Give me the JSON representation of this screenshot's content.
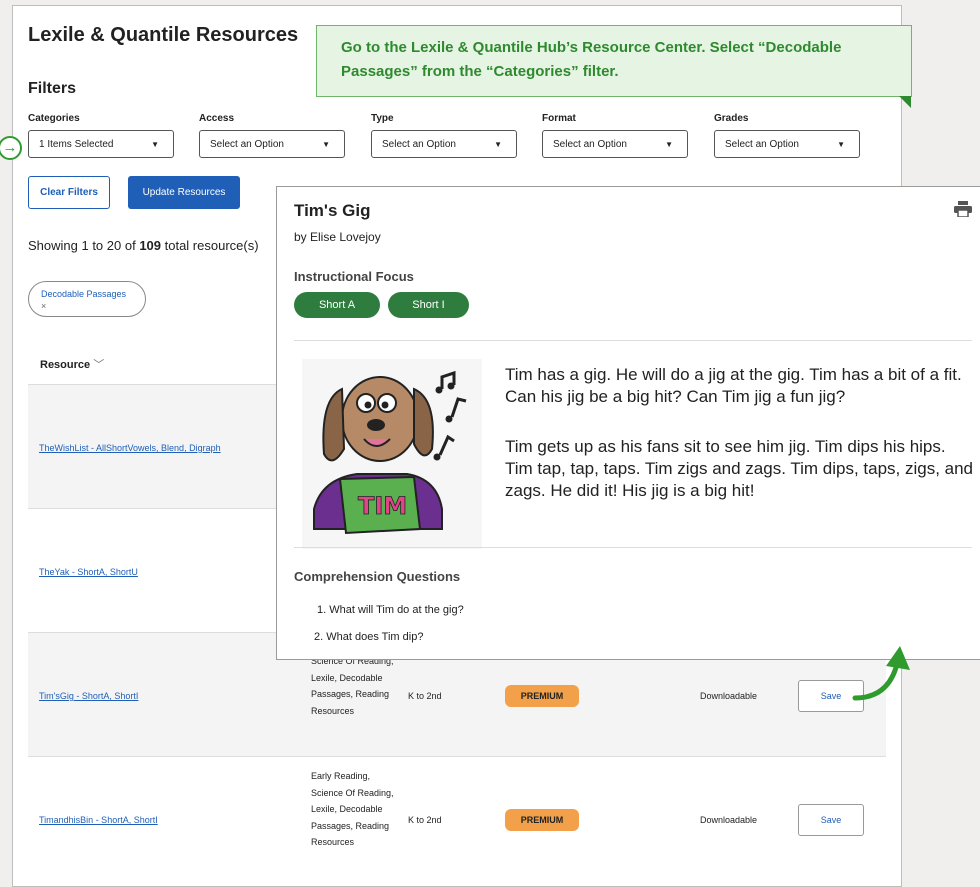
{
  "page": {
    "title": "Lexile & Quantile Resources",
    "filters_heading": "Filters"
  },
  "filters": [
    {
      "label": "Categories",
      "value": "1 Items Selected"
    },
    {
      "label": "Access",
      "value": "Select an Option"
    },
    {
      "label": "Type",
      "value": "Select an Option"
    },
    {
      "label": "Format",
      "value": "Select an Option"
    },
    {
      "label": "Grades",
      "value": "Select an Option"
    }
  ],
  "buttons": {
    "clear": "Clear Filters",
    "update": "Update Resources"
  },
  "results": {
    "prefix": "Showing 1 to 20 of ",
    "count": "109",
    "suffix": " total resource(s)"
  },
  "chip": {
    "label": "Decodable Passages",
    "remove": "×"
  },
  "table": {
    "column_resource": "Resource"
  },
  "rows": [
    {
      "name": "TheWishList - AllShortVowels, Blend, Digraph"
    },
    {
      "name": "TheYak - ShortA, ShortU"
    },
    {
      "name": "Tim'sGig - ShortA, ShortI",
      "categories": "Science Of Reading, Lexile, Decodable Passages, Reading Resources",
      "grades": "K to 2nd",
      "badge": "PREMIUM",
      "format": "Downloadable",
      "save": "Save"
    },
    {
      "name": "TimandhisBin - ShortA, ShortI",
      "categories": "Early Reading, Science Of Reading, Lexile, Decodable Passages, Reading Resources",
      "grades": "K to 2nd",
      "badge": "PREMIUM",
      "format": "Downloadable",
      "save": "Save"
    }
  ],
  "callout": {
    "text": "Go to the Lexile & Quantile Hub’s Resource Center. Select “Decodable Passages” from the “Categories” filter."
  },
  "modal": {
    "title": "Tim's Gig",
    "author": "by Elise Lovejoy",
    "focus_heading": "Instructional Focus",
    "focus_tags": [
      "Short A",
      "Short I"
    ],
    "paragraph1": "Tim has a gig. He will do a jig at the gig. Tim has a bit of a fit. Can his jig be a big hit? Can Tim jig a fun jig?",
    "paragraph2": "Tim gets up as his fans sit to see him jig. Tim dips his hips. Tim tap, tap, taps. Tim zigs and zags. Tim dips, taps, zigs, and zags. He did it! His jig is a big hit!",
    "illustration_text": "TIM",
    "questions_heading": "Comprehension Questions",
    "questions": [
      "1. What will Tim do at the gig?",
      "2. What does Tim dip?"
    ]
  },
  "colors": {
    "accent": "#1f5fb8",
    "green": "#2e7d3f",
    "premium": "#f3a04a",
    "callout_bg": "#e6f4e4"
  }
}
